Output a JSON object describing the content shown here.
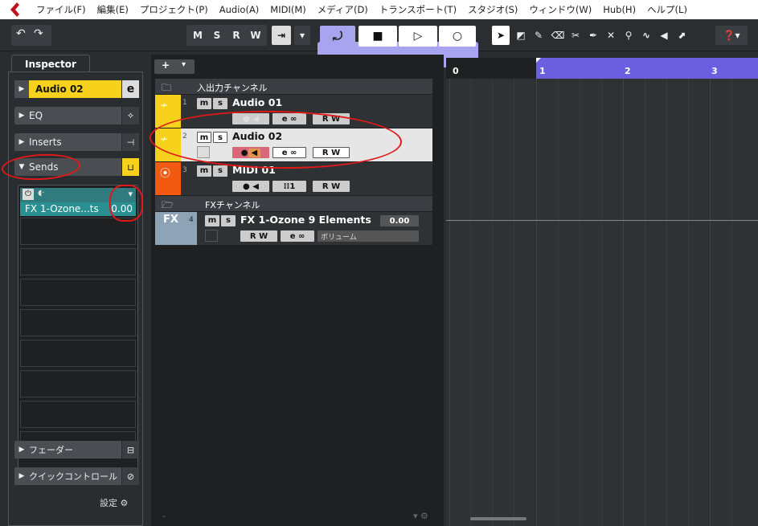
{
  "menu": [
    "ファイル(F)",
    "編集(E)",
    "プロジェクト(P)",
    "Audio(A)",
    "MIDI(M)",
    "メディア(D)",
    "トランスポート(T)",
    "スタジオ(S)",
    "ウィンドウ(W)",
    "Hub(H)",
    "ヘルプ(L)"
  ],
  "toolbar": {
    "m": "M",
    "s": "S",
    "r": "R",
    "w": "W"
  },
  "inspector": {
    "tab": "Inspector",
    "track_name": "Audio 02",
    "sections": {
      "eq": "EQ",
      "inserts": "Inserts",
      "sends": "Sends",
      "fader": "フェーダー",
      "quick": "クイックコントロール"
    },
    "send1": {
      "name": "FX 1-Ozone...ts",
      "value": "0.00"
    },
    "settings": "設定"
  },
  "tracks": {
    "folder1": "入出力チャンネル",
    "audio01": {
      "num": "1",
      "name": "Audio 01"
    },
    "audio02": {
      "num": "2",
      "name": "Audio 02"
    },
    "midi01": {
      "num": "3",
      "name": "MIDI 01",
      "chan": "1"
    },
    "folder2": "FXチャンネル",
    "fx1": {
      "num": "4",
      "name": "FX 1-Ozone 9 Elements",
      "value": "0.00",
      "vol": "ボリューム",
      "tag": "FX"
    }
  },
  "ruler": [
    "0",
    "1",
    "2",
    "3"
  ],
  "colors": {
    "audio": "#f7d21c",
    "midi": "#f25a12",
    "fx": "#8fa3b6",
    "cycle": "#6b5fe0"
  }
}
